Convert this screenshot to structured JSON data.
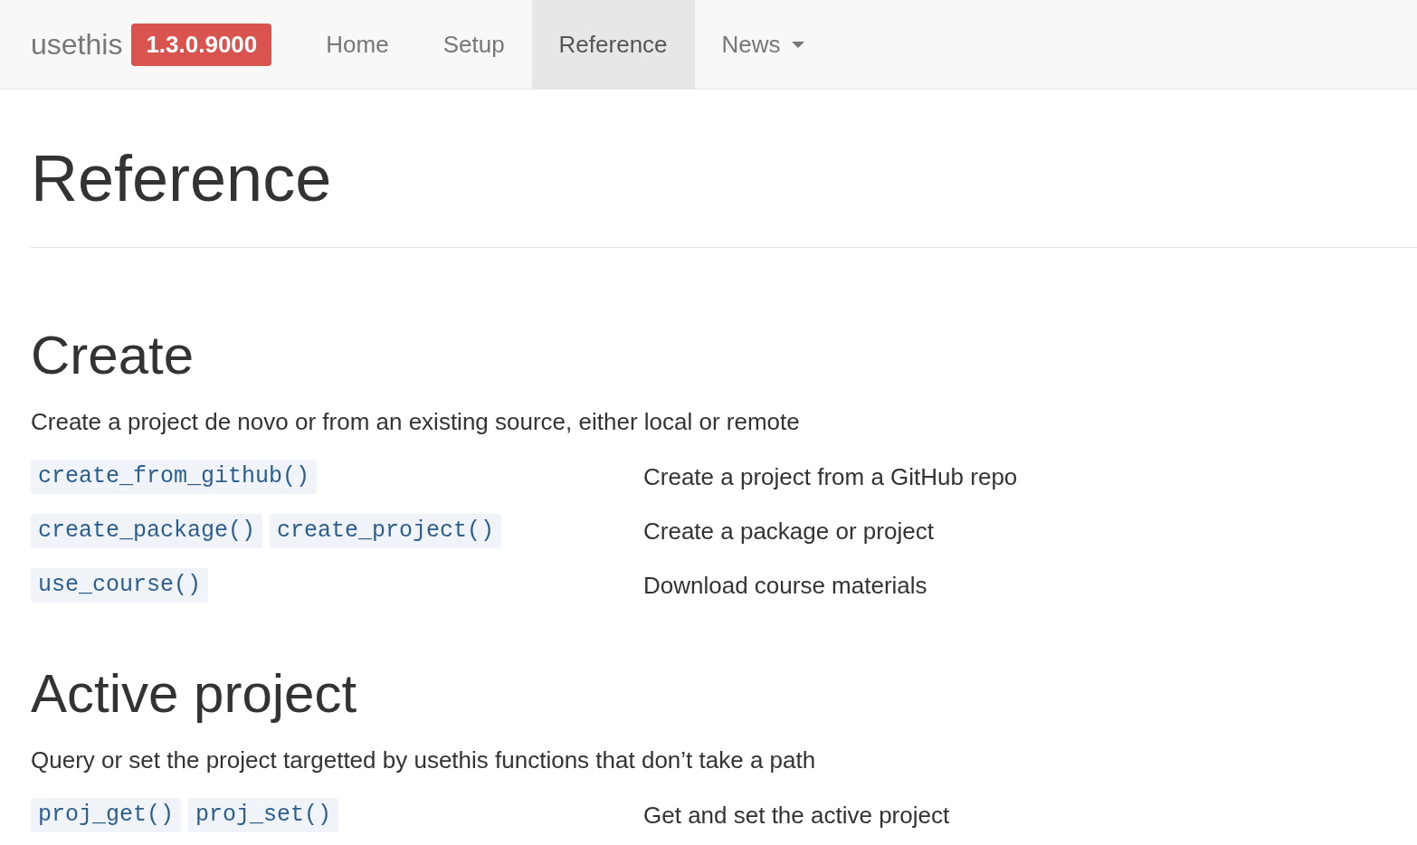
{
  "navbar": {
    "brand": "usethis",
    "version": "1.3.0.9000",
    "items": [
      {
        "label": "Home",
        "selected": false,
        "kind": "link"
      },
      {
        "label": "Setup",
        "selected": false,
        "kind": "link"
      },
      {
        "label": "Reference",
        "selected": true,
        "kind": "link"
      },
      {
        "label": "News",
        "selected": false,
        "kind": "dropdown"
      }
    ]
  },
  "title": "Reference",
  "sections": [
    {
      "heading": "Create",
      "description": "Create a project de novo or from an existing source, either local or remote",
      "rows": [
        {
          "functions": [
            "create_from_github()"
          ],
          "summary": "Create a project from a GitHub repo"
        },
        {
          "functions": [
            "create_package()",
            "create_project()"
          ],
          "summary": "Create a package or project"
        },
        {
          "functions": [
            "use_course()"
          ],
          "summary": "Download course materials"
        }
      ]
    },
    {
      "heading": "Active project",
      "description": "Query or set the project targetted by usethis functions that don’t take a path",
      "rows": [
        {
          "functions": [
            "proj_get()",
            "proj_set()"
          ],
          "summary": "Get and set the active project"
        }
      ]
    }
  ]
}
